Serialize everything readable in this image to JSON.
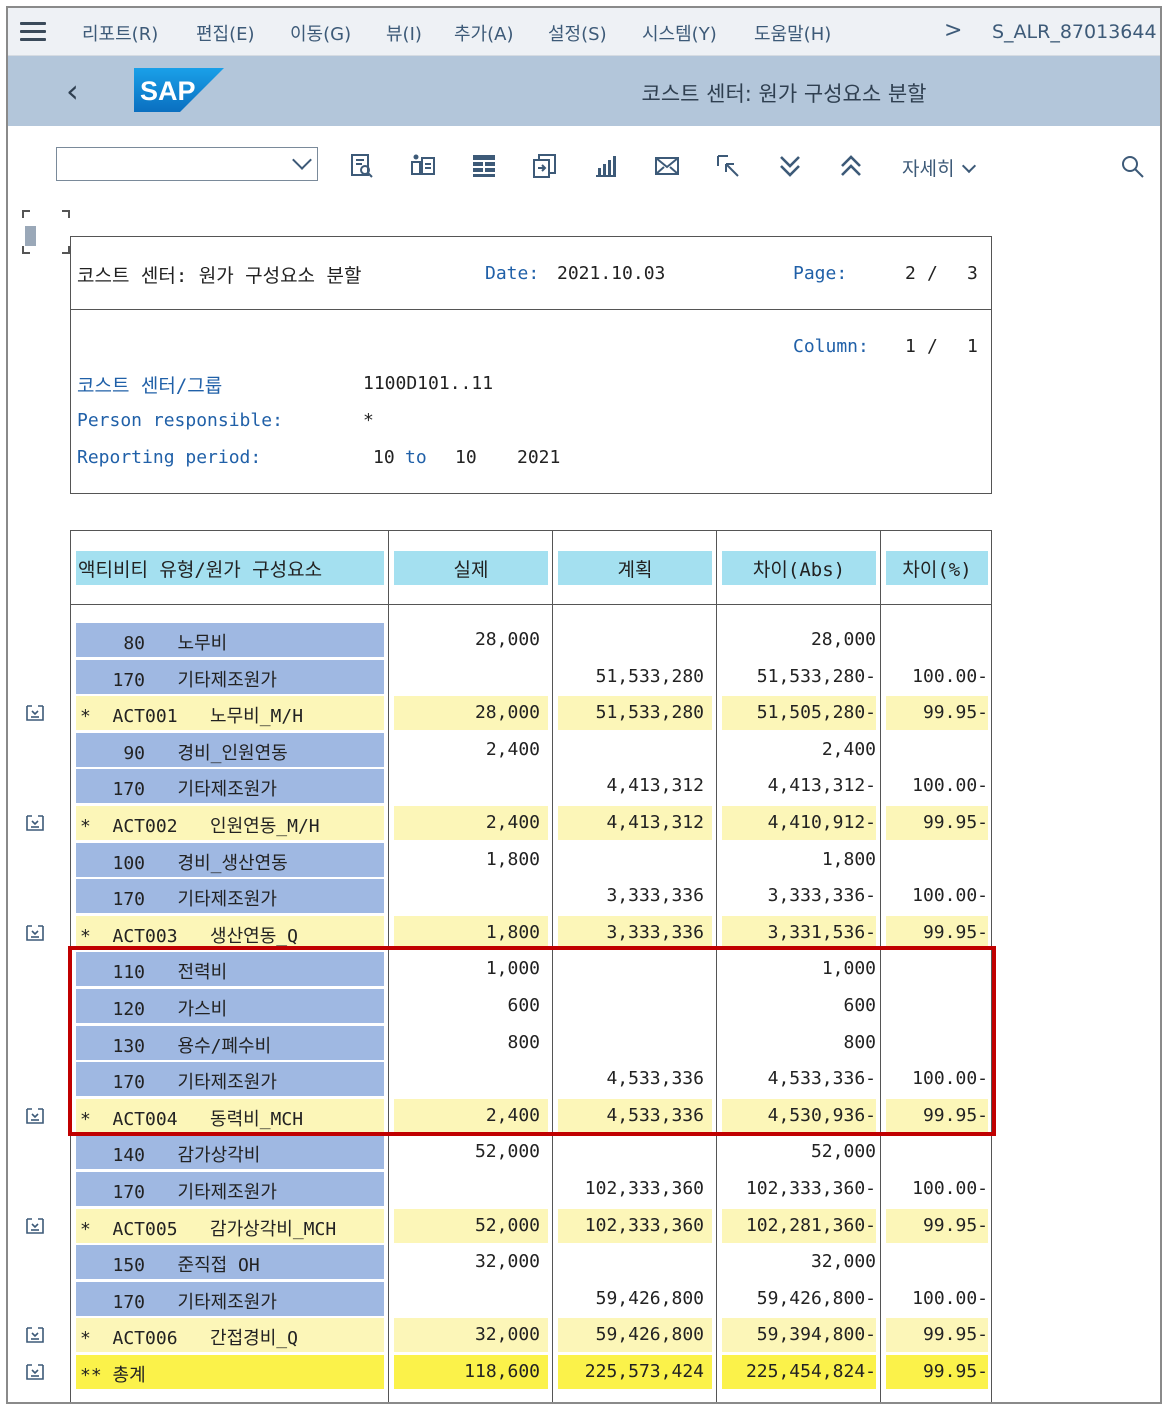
{
  "menubar": {
    "items": [
      "리포트(R)",
      "편집(E)",
      "이동(G)",
      "뷰(I)",
      "추가(A)",
      "설정(S)",
      "시스템(Y)",
      "도움말(H)"
    ],
    "transaction": "S_ALR_87013644"
  },
  "titlebar": {
    "logo_text": "SAP",
    "title": "코스트 센터: 원가 구성요소 분할"
  },
  "toolbar": {
    "dropdown_value": "",
    "more_label": "자세히",
    "icons": [
      "details-icon",
      "sum-icon",
      "layout-icon",
      "export-icon",
      "chart-icon",
      "mail-icon",
      "navigate-icon",
      "expand-all-icon",
      "collapse-all-icon"
    ]
  },
  "header": {
    "title": "코스트 센터: 원가 구성요소 분할",
    "date_label": "Date:",
    "date": "2021.10.03",
    "page_label": "Page:",
    "page_current": "2",
    "page_sep": "/",
    "page_total": "3",
    "column_label": "Column:",
    "column_current": "1",
    "column_sep": "/",
    "column_total": "1",
    "costcenter_label": "코스트 센터/그룹",
    "costcenter_value": "1100D101..11",
    "person_label": "Person responsible:",
    "person_value": "*",
    "period_label": "Reporting period:",
    "period_from": "10",
    "period_to_word": "to",
    "period_to": "10",
    "period_year": "2021"
  },
  "table": {
    "columns": [
      "액티비티 유형/원가 구성요소",
      "실제",
      "계획",
      "차이(Abs)",
      "차이(%)"
    ],
    "rows": [
      {
        "type": "detail",
        "label": "    80   노무비",
        "actual": "28,000",
        "plan": "",
        "abs": "28,000",
        "pct": ""
      },
      {
        "type": "detail",
        "label": "   170   기타제조원가",
        "actual": "",
        "plan": "51,533,280",
        "abs": "51,533,280-",
        "pct": "100.00-"
      },
      {
        "type": "sub",
        "label": "*  ACT001   노무비_M/H",
        "actual": "28,000",
        "plan": "51,533,280",
        "abs": "51,505,280-",
        "pct": "99.95-"
      },
      {
        "type": "detail",
        "label": "    90   경비_인원연동",
        "actual": "2,400",
        "plan": "",
        "abs": "2,400",
        "pct": ""
      },
      {
        "type": "detail",
        "label": "   170   기타제조원가",
        "actual": "",
        "plan": "4,413,312",
        "abs": "4,413,312-",
        "pct": "100.00-"
      },
      {
        "type": "sub",
        "label": "*  ACT002   인원연동_M/H",
        "actual": "2,400",
        "plan": "4,413,312",
        "abs": "4,410,912-",
        "pct": "99.95-"
      },
      {
        "type": "detail",
        "label": "   100   경비_생산연동",
        "actual": "1,800",
        "plan": "",
        "abs": "1,800",
        "pct": ""
      },
      {
        "type": "detail",
        "label": "   170   기타제조원가",
        "actual": "",
        "plan": "3,333,336",
        "abs": "3,333,336-",
        "pct": "100.00-"
      },
      {
        "type": "sub",
        "label": "*  ACT003   생산연동_Q",
        "actual": "1,800",
        "plan": "3,333,336",
        "abs": "3,331,536-",
        "pct": "99.95-"
      },
      {
        "type": "detail",
        "label": "   110   전력비",
        "actual": "1,000",
        "plan": "",
        "abs": "1,000",
        "pct": ""
      },
      {
        "type": "detail",
        "label": "   120   가스비",
        "actual": "600",
        "plan": "",
        "abs": "600",
        "pct": ""
      },
      {
        "type": "detail",
        "label": "   130   용수/폐수비",
        "actual": "800",
        "plan": "",
        "abs": "800",
        "pct": ""
      },
      {
        "type": "detail",
        "label": "   170   기타제조원가",
        "actual": "",
        "plan": "4,533,336",
        "abs": "4,533,336-",
        "pct": "100.00-"
      },
      {
        "type": "sub",
        "label": "*  ACT004   동력비_MCH",
        "actual": "2,400",
        "plan": "4,533,336",
        "abs": "4,530,936-",
        "pct": "99.95-"
      },
      {
        "type": "detail",
        "label": "   140   감가상각비",
        "actual": "52,000",
        "plan": "",
        "abs": "52,000",
        "pct": ""
      },
      {
        "type": "detail",
        "label": "   170   기타제조원가",
        "actual": "",
        "plan": "102,333,360",
        "abs": "102,333,360-",
        "pct": "100.00-"
      },
      {
        "type": "sub",
        "label": "*  ACT005   감가상각비_MCH",
        "actual": "52,000",
        "plan": "102,333,360",
        "abs": "102,281,360-",
        "pct": "99.95-"
      },
      {
        "type": "detail",
        "label": "   150   준직접 OH",
        "actual": "32,000",
        "plan": "",
        "abs": "32,000",
        "pct": ""
      },
      {
        "type": "detail",
        "label": "   170   기타제조원가",
        "actual": "",
        "plan": "59,426,800",
        "abs": "59,426,800-",
        "pct": "100.00-"
      },
      {
        "type": "sub",
        "label": "*  ACT006   간접경비_Q",
        "actual": "32,000",
        "plan": "59,426,800",
        "abs": "59,394,800-",
        "pct": "99.95-"
      },
      {
        "type": "total",
        "label": "** 총계",
        "actual": "118,600",
        "plan": "225,573,424",
        "abs": "225,454,824-",
        "pct": "99.95-"
      }
    ]
  },
  "colors": {
    "menubar_bg": "#eef1f5",
    "titlebar_bg": "#b3c6da",
    "column_header_bg": "#a4e0f0",
    "detail_label_bg": "#9fb8e2",
    "subtotal_bg": "#fcf6b8",
    "total_bg": "#fbf24a",
    "highlight_border": "#c00000",
    "label_blue": "#2060a8"
  }
}
